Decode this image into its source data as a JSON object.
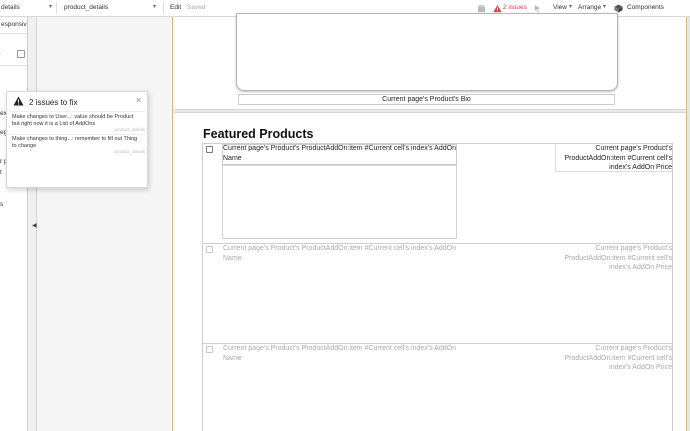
{
  "topbar": {
    "page_left": "details",
    "page_select": "product_details",
    "edit_label": "Edit",
    "saved_label": "Saved",
    "issues_label": "2 issues",
    "view_label": "View",
    "arrange_label": "Arrange",
    "components_label": "Components"
  },
  "left_panel": {
    "responsive_label": "esponsive",
    "partial_items": [
      "ex",
      "eg",
      "r p",
      "t",
      "s"
    ]
  },
  "canvas": {
    "bio_label": "Current page's Product's Bio",
    "section_heading": "Featured Products",
    "cells": [
      {
        "name": "Current page's Product's ProductAddOn:item #Current cell's index's AddOn Name",
        "price": "Current page's Product's ProductAddOn:item #Current cell's index's AddOn Price"
      },
      {
        "name": "Current page's Product's ProductAddOn:item #Current cell's index's AddOn Name",
        "price": "Current page's Product's ProductAddOn:item #Current cell's index's AddOn Price"
      },
      {
        "name": "Current page's Product's ProductAddOn:item #Current cell's index's AddOn Name",
        "price": "Current page's Product's ProductAddOn:item #Current cell's index's AddOn Price"
      }
    ]
  },
  "issues_popup": {
    "title": "2 issues to fix",
    "issues": [
      {
        "message": "Make changes to User...: value should be Product but right now it is a List of AddOns",
        "source": "product_details"
      },
      {
        "message": "Make changes to thing...: remember to fill out Thing to change",
        "source": "product_details"
      }
    ]
  },
  "colors": {
    "accent_issue": "#e0394b",
    "guide": "#f0b44b"
  },
  "icons": [
    "chevron-down-icon",
    "warning-icon",
    "close-icon",
    "cube-icon",
    "cursor-icon",
    "box-icon"
  ]
}
